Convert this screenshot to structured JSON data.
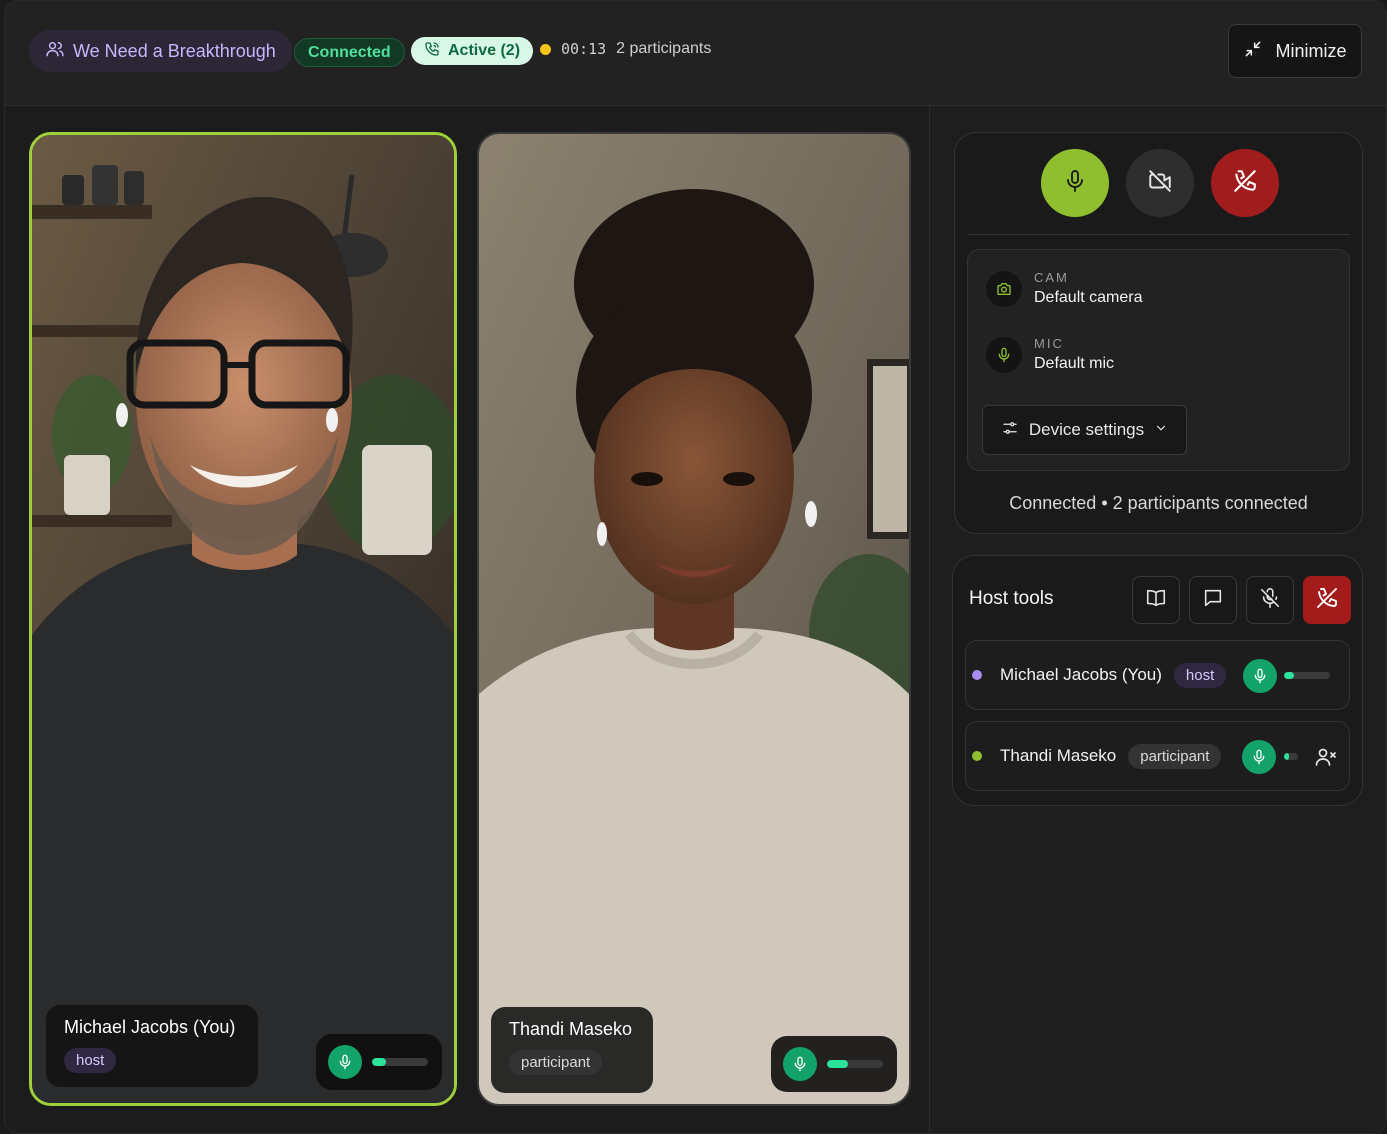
{
  "header": {
    "room_name": "We Need a Breakthrough",
    "connection_status": "Connected",
    "call_state": "Active (2)",
    "elapsed_time": "00:13",
    "participant_count": "2 participants",
    "minimize_label": "Minimize"
  },
  "tiles": [
    {
      "name": "Michael Jacobs (You)",
      "role": "host",
      "audio_level": 0.25
    },
    {
      "name": "Thandi Maseko",
      "role": "participant",
      "audio_level": 0.38
    }
  ],
  "controls": {
    "mic_state": "on",
    "camera_state": "off"
  },
  "devices": {
    "cam_label": "CAM",
    "cam_value": "Default camera",
    "mic_label": "MIC",
    "mic_value": "Default mic",
    "settings_label": "Device settings"
  },
  "status_line": "Connected • 2 participants connected",
  "host_tools": {
    "title": "Host tools",
    "participants": [
      {
        "name": "Michael Jacobs (You)",
        "role": "host",
        "dot_color": "#a98cf0",
        "audio_level": 0.22
      },
      {
        "name": "Thandi Maseko",
        "role": "participant",
        "dot_color": "#8fbf2e",
        "audio_level": 0.35
      }
    ]
  },
  "colors": {
    "accent_green": "#8fbf2e",
    "danger_red": "#a11d1d",
    "mic_green": "#13a36a"
  }
}
